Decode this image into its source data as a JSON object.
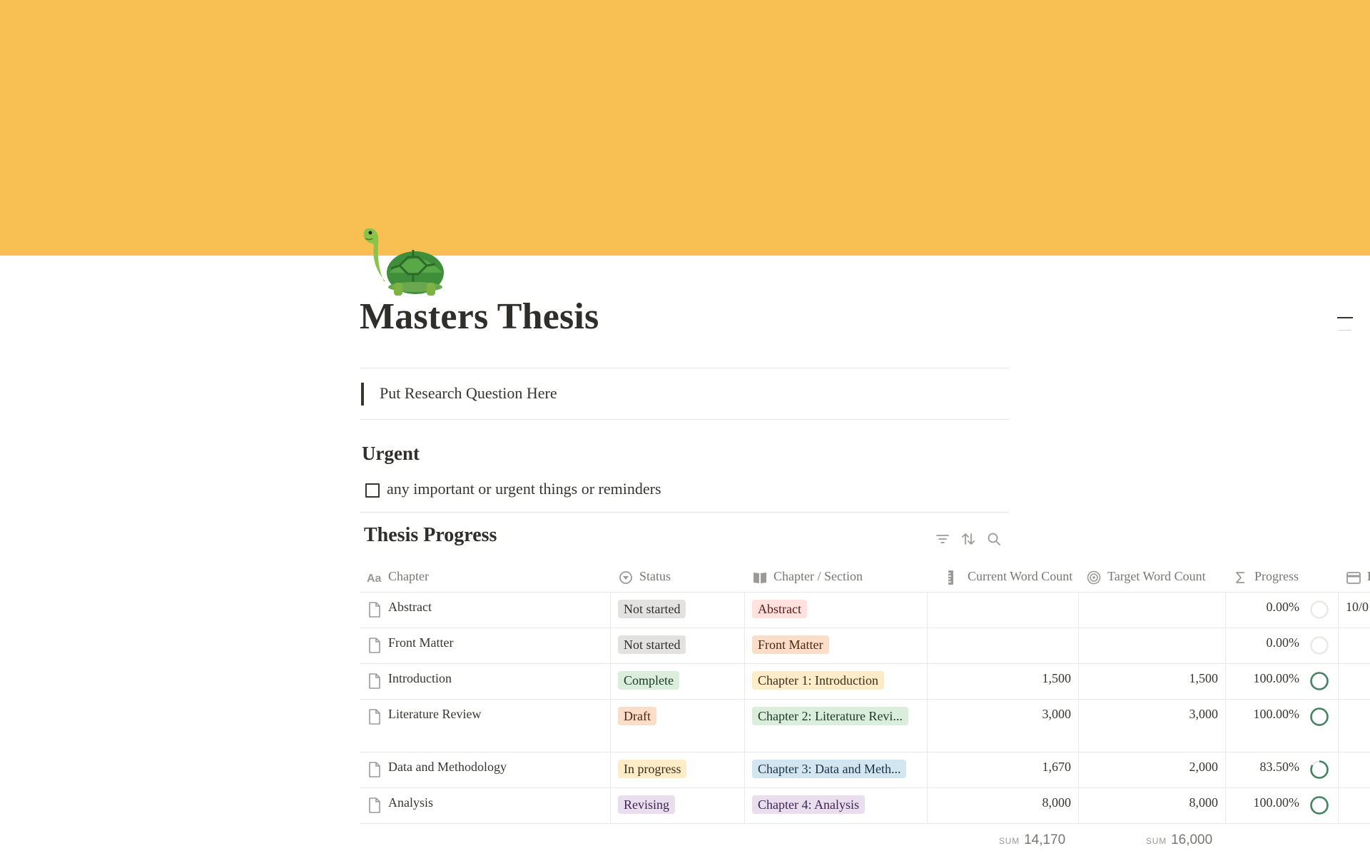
{
  "page": {
    "icon": "turtle-emoji",
    "title": "Masters Thesis",
    "cover_color": "#f8c053"
  },
  "quote": {
    "text": "Put Research Question Here"
  },
  "urgent": {
    "heading": "Urgent",
    "todo": {
      "label": "any important or urgent things or reminders",
      "checked": false
    }
  },
  "database": {
    "title": "Thesis Progress",
    "tools": [
      "filter-icon",
      "sort-icon",
      "search-icon"
    ],
    "columns": [
      {
        "label": "Chapter",
        "icon": "title-aa-icon"
      },
      {
        "label": "Status",
        "icon": "status-icon"
      },
      {
        "label": "Chapter / Section",
        "icon": "book-icon"
      },
      {
        "label": "Current Word Count",
        "icon": "ruler-icon"
      },
      {
        "label": "Target Word Count",
        "icon": "target-icon"
      },
      {
        "label": "Progress",
        "icon": "sigma-icon"
      },
      {
        "label": "D",
        "icon": "calendar-icon"
      }
    ],
    "rows": [
      {
        "chapter": "Abstract",
        "status": "Not started",
        "section": "Abstract",
        "current": "",
        "target": "",
        "progress": "0.00%",
        "progress_value": 0.0,
        "date": "10/0"
      },
      {
        "chapter": "Front Matter",
        "status": "Not started",
        "section": "Front Matter",
        "current": "",
        "target": "",
        "progress": "0.00%",
        "progress_value": 0.0,
        "date": ""
      },
      {
        "chapter": "Introduction",
        "status": "Complete",
        "section": "Chapter 1: Introduction",
        "current": "1,500",
        "target": "1,500",
        "progress": "100.00%",
        "progress_value": 1.0,
        "date": ""
      },
      {
        "chapter": "Literature Review",
        "status": "Draft",
        "section": "Chapter 2: Literature Revi...",
        "current": "3,000",
        "target": "3,000",
        "progress": "100.00%",
        "progress_value": 1.0,
        "date": ""
      },
      {
        "chapter": "Data and Methodology",
        "status": "In progress",
        "section": "Chapter 3: Data and Meth...",
        "current": "1,670",
        "target": "2,000",
        "progress": "83.50%",
        "progress_value": 0.835,
        "date": ""
      },
      {
        "chapter": "Analysis",
        "status": "Revising",
        "section": "Chapter 4: Analysis",
        "current": "8,000",
        "target": "8,000",
        "progress": "100.00%",
        "progress_value": 1.0,
        "date": ""
      }
    ],
    "status_colors": {
      "Not started": {
        "bg": "#e3e2e0",
        "fg": "#32302c"
      },
      "Complete": {
        "bg": "#dbeddb",
        "fg": "#1c3829"
      },
      "Draft": {
        "bg": "#fadec9",
        "fg": "#49290e"
      },
      "In progress": {
        "bg": "#fdecc8",
        "fg": "#402c1b"
      },
      "Revising": {
        "bg": "#e8deee",
        "fg": "#412454"
      }
    },
    "section_colors": {
      "Abstract": {
        "bg": "#ffe2dd",
        "fg": "#5d1715"
      },
      "Front Matter": {
        "bg": "#fadec9",
        "fg": "#49290e"
      },
      "Chapter 1: Introduction": {
        "bg": "#fdecc8",
        "fg": "#402c1b"
      },
      "Chapter 2: Literature Revi...": {
        "bg": "#dbeddb",
        "fg": "#1c3829"
      },
      "Chapter 3: Data and Meth...": {
        "bg": "#d3e5ef",
        "fg": "#183347"
      },
      "Chapter 4: Analysis": {
        "bg": "#e8deee",
        "fg": "#412454"
      }
    },
    "progress_color": "#448361",
    "sums": {
      "label": "SUM",
      "current": "14,170",
      "target": "16,000"
    }
  }
}
